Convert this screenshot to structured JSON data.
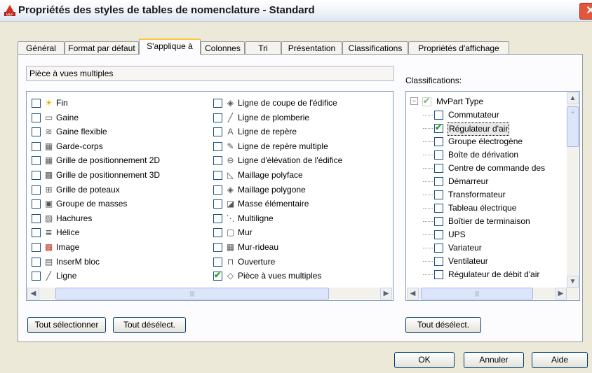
{
  "window": {
    "title": "Propriétés des styles de tables de nomenclature - Standard",
    "app_icon": "autocad-mep-icon",
    "close_label": "✕"
  },
  "tabs": [
    {
      "label": "Général",
      "active": false
    },
    {
      "label": "Format par défaut",
      "active": false
    },
    {
      "label": "S'applique à",
      "active": true
    },
    {
      "label": "Colonnes",
      "active": false
    },
    {
      "label": "Tri",
      "active": false
    },
    {
      "label": "Présentation",
      "active": false
    },
    {
      "label": "Classifications",
      "active": false
    },
    {
      "label": "Propriétés d'affichage",
      "active": false
    }
  ],
  "applies_to": {
    "field_value": "Pièce à vues multiples",
    "items_col1": [
      {
        "label": "Fin",
        "icon": "sun-icon",
        "checked": false
      },
      {
        "label": "Gaine",
        "icon": "duct-icon",
        "checked": false
      },
      {
        "label": "Gaine flexible",
        "icon": "flex-duct-icon",
        "checked": false
      },
      {
        "label": "Garde-corps",
        "icon": "railing-icon",
        "checked": false
      },
      {
        "label": "Grille de positionnement 2D",
        "icon": "grid-2d-icon",
        "checked": false
      },
      {
        "label": "Grille de positionnement 3D",
        "icon": "grid-3d-icon",
        "checked": false
      },
      {
        "label": "Grille de poteaux",
        "icon": "column-grid-icon",
        "checked": false
      },
      {
        "label": "Groupe de masses",
        "icon": "mass-group-icon",
        "checked": false
      },
      {
        "label": "Hachures",
        "icon": "hatch-icon",
        "checked": false
      },
      {
        "label": "Hélice",
        "icon": "helix-icon",
        "checked": false
      },
      {
        "label": "Image",
        "icon": "image-icon",
        "checked": false
      },
      {
        "label": "InserM bloc",
        "icon": "block-icon",
        "checked": false
      },
      {
        "label": "Ligne",
        "icon": "line-icon",
        "checked": false
      }
    ],
    "items_col2": [
      {
        "label": "Ligne de coupe de l'édifice",
        "icon": "section-line-icon",
        "checked": false
      },
      {
        "label": "Ligne de plomberie",
        "icon": "plumbing-line-icon",
        "checked": false
      },
      {
        "label": "Ligne de repère",
        "icon": "leader-icon",
        "checked": false
      },
      {
        "label": "Ligne de repère multiple",
        "icon": "multileader-icon",
        "checked": false
      },
      {
        "label": "Ligne d'élévation de l'édifice",
        "icon": "elevation-line-icon",
        "checked": false
      },
      {
        "label": "Maillage polyface",
        "icon": "polyface-mesh-icon",
        "checked": false
      },
      {
        "label": "Maillage polygone",
        "icon": "polygon-mesh-icon",
        "checked": false
      },
      {
        "label": "Masse élémentaire",
        "icon": "mass-element-icon",
        "checked": false
      },
      {
        "label": "Multiligne",
        "icon": "multiline-icon",
        "checked": false
      },
      {
        "label": "Mur",
        "icon": "wall-icon",
        "checked": false
      },
      {
        "label": "Mur-rideau",
        "icon": "curtain-wall-icon",
        "checked": false
      },
      {
        "label": "Ouverture",
        "icon": "opening-icon",
        "checked": false
      },
      {
        "label": "Pièce à vues multiples",
        "icon": "multiview-part-icon",
        "checked": true
      }
    ],
    "select_all": "Tout sélectionner",
    "deselect_all": "Tout désélect."
  },
  "classifications": {
    "label": "Classifications:",
    "root": {
      "label": "MvPart Type",
      "expanded": true
    },
    "children": [
      {
        "label": "Commutateur",
        "checked": false
      },
      {
        "label": "Régulateur d'air",
        "checked": true,
        "selected": true
      },
      {
        "label": "Groupe électrogène",
        "checked": false
      },
      {
        "label": "Boîte de dérivation",
        "checked": false
      },
      {
        "label": "Centre de commande des",
        "checked": false
      },
      {
        "label": "Démarreur",
        "checked": false
      },
      {
        "label": "Transformateur",
        "checked": false
      },
      {
        "label": "Tableau électrique",
        "checked": false
      },
      {
        "label": "Boîtier de terminaison",
        "checked": false
      },
      {
        "label": "UPS",
        "checked": false
      },
      {
        "label": "Variateur",
        "checked": false
      },
      {
        "label": "Ventilateur",
        "checked": false
      },
      {
        "label": "Régulateur de débit d'air",
        "checked": false
      }
    ],
    "deselect_all": "Tout désélect."
  },
  "footer": {
    "ok": "OK",
    "cancel": "Annuler",
    "help": "Aide"
  }
}
